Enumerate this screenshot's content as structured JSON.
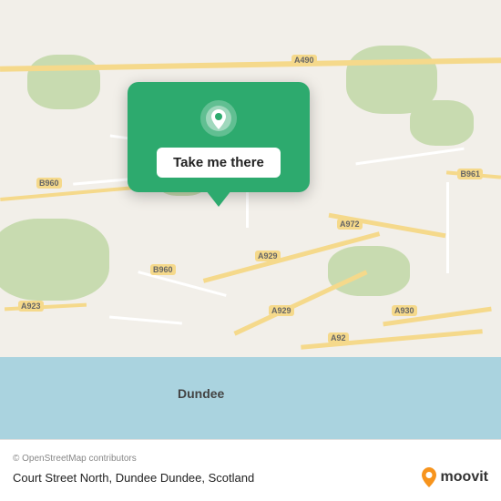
{
  "map": {
    "city": "Dundee",
    "copyright": "© OpenStreetMap contributors",
    "location_text": "Court Street North, Dundee Dundee, Scotland",
    "moovit_label": "moovit",
    "road_labels": {
      "b960_top": "B960",
      "b960_mid": "B960",
      "a929_1": "A929",
      "a929_2": "A929",
      "a972": "A972",
      "a930": "A930",
      "b961": "B961",
      "a92": "A92",
      "a923": "A923",
      "a490": "A490"
    }
  },
  "popup": {
    "button_label": "Take me there"
  }
}
